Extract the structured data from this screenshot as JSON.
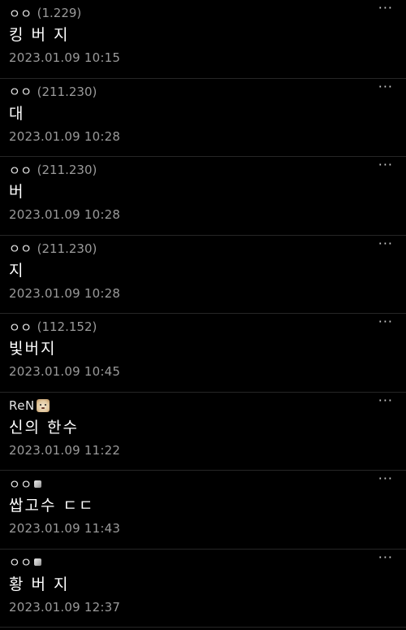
{
  "comments": [
    {
      "nick": "ㅇㅇ",
      "ip": "(1.229)",
      "text": "킹 버 지",
      "date": "2023.01.09 10:15",
      "badge": "none"
    },
    {
      "nick": "ㅇㅇ",
      "ip": "(211.230)",
      "text": "대",
      "date": "2023.01.09 10:28",
      "badge": "none"
    },
    {
      "nick": "ㅇㅇ",
      "ip": "(211.230)",
      "text": "버",
      "date": "2023.01.09 10:28",
      "badge": "none"
    },
    {
      "nick": "ㅇㅇ",
      "ip": "(211.230)",
      "text": "지",
      "date": "2023.01.09 10:28",
      "badge": "none"
    },
    {
      "nick": "ㅇㅇ",
      "ip": "(112.152)",
      "text": "빛버지",
      "date": "2023.01.09 10:45",
      "badge": "none"
    },
    {
      "nick": "ReN",
      "ip": "",
      "text": "신의 한수",
      "date": "2023.01.09 11:22",
      "badge": "dog-face-icon"
    },
    {
      "nick": "ㅇㅇ",
      "ip": "",
      "text": "쌉고수 ㄷㄷ",
      "date": "2023.01.09 11:43",
      "badge": "member-badge-icon"
    },
    {
      "nick": "ㅇㅇ",
      "ip": "",
      "text": "황 버 지",
      "date": "2023.01.09 12:37",
      "badge": "member-badge-icon"
    }
  ],
  "more_glyph": "···"
}
